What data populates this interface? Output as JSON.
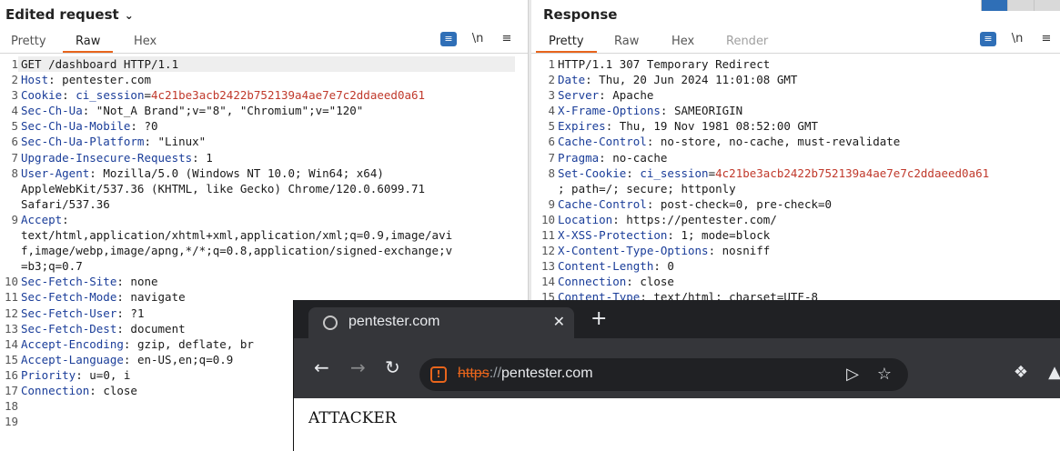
{
  "request": {
    "title": "Edited request",
    "tabs": [
      "Pretty",
      "Raw",
      "Hex"
    ],
    "active_tab": "Raw",
    "newline_label": "\\n",
    "lines": [
      {
        "n": "1",
        "text": "GET /dashboard HTTP/1.1"
      },
      {
        "n": "2",
        "key": "Host",
        "val": "pentester.com"
      },
      {
        "n": "3",
        "key": "Cookie",
        "ck": "ci_session",
        "cv": "4c21be3acb2422b752139a4ae7e7c2ddaeed0a61"
      },
      {
        "n": "4",
        "key": "Sec-Ch-Ua",
        "val": "\"Not_A Brand\";v=\"8\", \"Chromium\";v=\"120\""
      },
      {
        "n": "5",
        "key": "Sec-Ch-Ua-Mobile",
        "val": "?0"
      },
      {
        "n": "6",
        "key": "Sec-Ch-Ua-Platform",
        "val": "\"Linux\""
      },
      {
        "n": "7",
        "key": "Upgrade-Insecure-Requests",
        "val": "1"
      },
      {
        "n": "8",
        "key": "User-Agent",
        "val": "Mozilla/5.0 (Windows NT 10.0; Win64; x64)"
      },
      {
        "n": "",
        "text": "AppleWebKit/537.36 (KHTML, like Gecko) Chrome/120.0.6099.71"
      },
      {
        "n": "",
        "text": "Safari/537.36"
      },
      {
        "n": "9",
        "key": "Accept",
        "val": ""
      },
      {
        "n": "",
        "text": "text/html,application/xhtml+xml,application/xml;q=0.9,image/avi"
      },
      {
        "n": "",
        "text": "f,image/webp,image/apng,*/*;q=0.8,application/signed-exchange;v"
      },
      {
        "n": "",
        "text": "=b3;q=0.7"
      },
      {
        "n": "10",
        "key": "Sec-Fetch-Site",
        "val": "none"
      },
      {
        "n": "11",
        "key": "Sec-Fetch-Mode",
        "val": "navigate"
      },
      {
        "n": "12",
        "key": "Sec-Fetch-User",
        "val": "?1"
      },
      {
        "n": "13",
        "key": "Sec-Fetch-Dest",
        "val": "document"
      },
      {
        "n": "14",
        "key": "Accept-Encoding",
        "val": "gzip, deflate, br"
      },
      {
        "n": "15",
        "key": "Accept-Language",
        "val": "en-US,en;q=0.9"
      },
      {
        "n": "16",
        "key": "Priority",
        "val": "u=0, i"
      },
      {
        "n": "17",
        "key": "Connection",
        "val": "close"
      },
      {
        "n": "18",
        "text": ""
      },
      {
        "n": "19",
        "text": ""
      }
    ]
  },
  "response": {
    "title": "Response",
    "tabs": [
      "Pretty",
      "Raw",
      "Hex",
      "Render"
    ],
    "active_tab": "Pretty",
    "disabled_tab": "Render",
    "newline_label": "\\n",
    "lines": [
      {
        "n": "1",
        "text": "HTTP/1.1 307 Temporary Redirect"
      },
      {
        "n": "2",
        "key": "Date",
        "val": "Thu, 20 Jun 2024 11:01:08 GMT"
      },
      {
        "n": "3",
        "key": "Server",
        "val": "Apache"
      },
      {
        "n": "4",
        "key": "X-Frame-Options",
        "val": "SAMEORIGIN"
      },
      {
        "n": "5",
        "key": "Expires",
        "val": "Thu, 19 Nov 1981 08:52:00 GMT"
      },
      {
        "n": "6",
        "key": "Cache-Control",
        "val": "no-store, no-cache, must-revalidate"
      },
      {
        "n": "7",
        "key": "Pragma",
        "val": "no-cache"
      },
      {
        "n": "8",
        "key": "Set-Cookie",
        "ck": "ci_session",
        "cv": "4c21be3acb2422b752139a4ae7e7c2ddaeed0a61"
      },
      {
        "n": "",
        "text": "; path=/; secure; httponly"
      },
      {
        "n": "9",
        "key": "Cache-Control",
        "val": "post-check=0, pre-check=0"
      },
      {
        "n": "10",
        "key": "Location",
        "val": "https://pentester.com/"
      },
      {
        "n": "11",
        "key": "X-XSS-Protection",
        "val": "1; mode=block"
      },
      {
        "n": "12",
        "key": "X-Content-Type-Options",
        "val": "nosniff"
      },
      {
        "n": "13",
        "key": "Content-Length",
        "val": "0"
      },
      {
        "n": "14",
        "key": "Connection",
        "val": "close"
      },
      {
        "n": "15",
        "key": "Content-Type",
        "val": "text/html; charset=UTF-8"
      }
    ]
  },
  "browser": {
    "tab_title": "pentester.com",
    "url_scheme": "https",
    "url_sep": "://",
    "url_host": "pentester.com",
    "page_text": "ATTACKER",
    "accent_color": "#e8651c"
  }
}
